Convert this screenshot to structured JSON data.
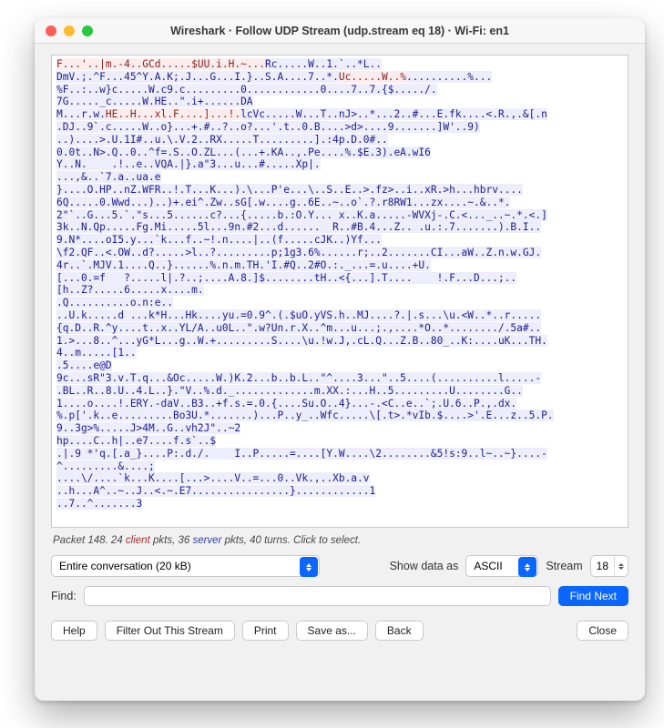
{
  "title": "Wireshark · Follow UDP Stream (udp.stream eq 18) · Wi-Fi: en1",
  "packetline": {
    "prefix": "Packet 148. 24 ",
    "client": "client",
    "mid": " pkts, 36 ",
    "server": "server",
    "suffix": " pkts, 40 turns. Click to select."
  },
  "conversation_label": "Entire conversation (20 kB)",
  "show_data_as_label": "Show data as",
  "show_data_as_value": "ASCII",
  "stream_label": "Stream",
  "stream_value": "18",
  "find_label": "Find:",
  "find_next": "Find Next",
  "buttons": {
    "help": "Help",
    "filter": "Filter Out This Stream",
    "print": "Print",
    "saveas": "Save as...",
    "back": "Back",
    "close": "Close"
  },
  "segments": [
    {
      "c": "cl",
      "t": "F...'..|m.-4..GCd.....$UU.i.H.~..."
    },
    {
      "c": "sv",
      "t": "Rc.....W..1.`..*L..\nDmV.;.^F...45^Y.A.K;.J...G...I.}..S.A....7..*."
    },
    {
      "c": "cl",
      "t": "Uc.....W..%"
    },
    {
      "c": "sv",
      "t": "..........%...\n%F..:..w}c.....W.c9.c.........0............0....7..7.{$...../.\n7G....._c.....W.HE..\".i+......DA\nM...r.w."
    },
    {
      "c": "cl",
      "t": "HE..H...xl.F....]...!."
    },
    {
      "c": "sv",
      "t": "lcVc.....W...T..nJ>..*...2..#...E.fk....<.R.,.&[.n\n.DJ..9`.c.....W..o}...+.#..?..o?...'.t..0.B....>d>....9.......]W'..9)\n..)....>.U.1I#..u.\\.V.2..RX.....T.........].:4p.D.0#..\n0.0t..N>.Q..0..^f=.S..O.ZL...(...+.KA..,.Pe....%.$E.3).eA.wI6\nY..N.    .!..e..VQA.|}.a\"3...u...#.....Xp|.\n...,&..`7.a..ua.e\n}....O.HP..nZ.WFR..!.T...K...).\\...P'e...\\..S..E..>.fz>..i..xR.>h...hbrv....\n6Q.....0.Wwd...)..)+.ei^.Zw..sG[.w....g..6E..~..o`.?.r8RW1...zx....~.&..*.\n2\"`..G...5.`.\"s...5......c?...{.....b.:O.Y... x..K.a.....-WVXj-.C.<..._..~.*.<.]\n3k..N.Qp.....Fg.Mi.....5l...9n.#2...d......  R..#B.4...Z.. .u.:.7.......).B.I..\n9.N*....oI5.y...`k...f..~!.n....|..(f.....cJK..)Yf...\n\\f2.QF..<.OW..d?.....>l..?.........p;1g3.6%......r;..2.......CI...aW..Z.n.w.GJ.\n4r..`.MJV.1....Q..}......%.n.m.TH.'I.#Q..2#O.:._...=.u....+U.\n[...0.=f   ?.....l|.?..;....A.8.]$........tH..<{...].T....    !.F...D...;..\n[h..Z?.....6.....x....m.\n.Q..........o.n:e..\n..U.k.....d ...k*H...Hk....yu.=0.9^.(.$uO.yVS.h..MJ....?.|.s...\\u.<W..*..r.....\n{q.D..R.^y....t..x..YL/A..u0L..\".w?Un.r.X..^m...u...;.,....*O..*......../.5a#..\n1.>...8..^...yG*L...g..W.+.........S....\\u.!w.J,.cL.Q...Z.B..80_..K:....uK...TH.\n4..m.....[1..\n.5....e@D\n9c...sR\"3.v.T.q...&Oc.....W.)K.2...b..b.L..\"^....3...\"..5....(..........l.....-\n.BL..R..8.U..4.L..}.\"V..%.d._.............m.XX.:...H..5.........U........G..\n1....o....!.ERY.-daV..B3..+f.s.=.0.{....Su.O..4}...-.<C..e..`;.U.6..P.,.dx.\n%.p['.k..e.........Bo3U.*.......)...P..y_..Wfc.....\\[.t>.*vIb.$....>'.E...z..5.P.\n9..3g>%.....J>4M..G..vh2J\"..~2\nhp....C..h|..e7....f.s`..$\n.|.9 *'q.[.a_}....P:.d./.    I..P.....=....[Y.W....\\2........&5!s:9..l~..~}....-\n^.........&....;\n....\\/....`k...K....[...>....V..=...0..Vk.,..Xb.a.v\n..h...A^..~..J..<.~.E7................}............1"
    },
    {
      "c": "sv",
      "t": "\n..7..^.......3"
    }
  ]
}
